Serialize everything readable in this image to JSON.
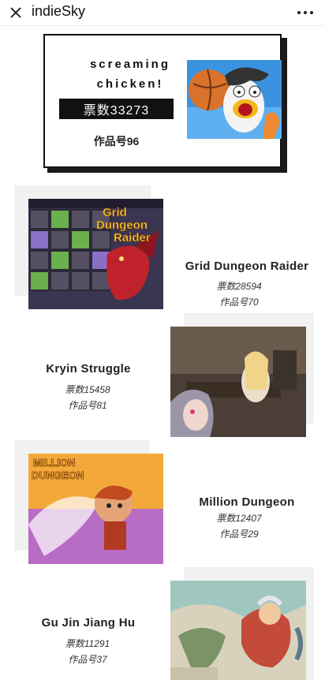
{
  "app": {
    "title": "indieSky"
  },
  "featured": {
    "name_line1": "screaming",
    "name_line2": "chicken!",
    "votes": "票数33273",
    "entry": "作品号96",
    "thumb_icon": "screaming-chicken-art"
  },
  "items": [
    {
      "title": "Grid Dungeon Raider",
      "votes": "票数28594",
      "entry": "作品号70",
      "image_text_line1": "Grid",
      "image_text_line2": "Dungeon",
      "image_text_line3": "Raider"
    },
    {
      "title": "Kryin Struggle",
      "votes": "票数15458",
      "entry": "作品号81"
    },
    {
      "title": "Million Dungeon",
      "votes": "票数12407",
      "entry": "作品号29",
      "image_text_line1": "MILLION",
      "image_text_line2": "DUNGEON"
    },
    {
      "title": "Gu Jin Jiang Hu",
      "votes": "票数11291",
      "entry": "作品号37"
    }
  ],
  "colors": {
    "accent": "#111111",
    "panel": "#f1f1f1"
  }
}
